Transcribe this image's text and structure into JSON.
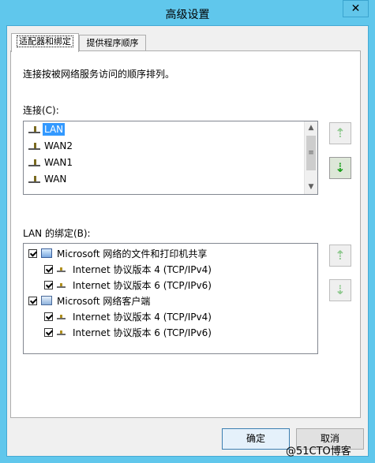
{
  "window": {
    "title": "高级设置",
    "close_glyph": "✕"
  },
  "tabs": [
    {
      "label": "适配器和绑定",
      "active": true
    },
    {
      "label": "提供程序顺序",
      "active": false
    }
  ],
  "panel": {
    "instruction": "连接按被网络服务访问的顺序排列。",
    "connections_label": "连接(C):",
    "connections": [
      {
        "name": "LAN",
        "icon": "network-adapter-icon",
        "selected": true
      },
      {
        "name": "WAN2",
        "icon": "network-adapter-icon",
        "selected": false
      },
      {
        "name": "WAN1",
        "icon": "network-adapter-icon",
        "selected": false
      },
      {
        "name": "WAN",
        "icon": "network-adapter-icon",
        "selected": false
      }
    ],
    "bindings_label": "LAN 的绑定(B):",
    "bindings": [
      {
        "name": "Microsoft 网络的文件和打印机共享",
        "level": 0,
        "checked": true,
        "icon": "file-printer-sharing-icon"
      },
      {
        "name": "Internet 协议版本 4 (TCP/IPv4)",
        "level": 1,
        "checked": true,
        "icon": "protocol-icon"
      },
      {
        "name": "Internet 协议版本 6 (TCP/IPv6)",
        "level": 1,
        "checked": true,
        "icon": "protocol-icon"
      },
      {
        "name": "Microsoft 网络客户端",
        "level": 0,
        "checked": true,
        "icon": "network-client-icon"
      },
      {
        "name": "Internet 协议版本 4 (TCP/IPv4)",
        "level": 1,
        "checked": true,
        "icon": "protocol-icon"
      },
      {
        "name": "Internet 协议版本 6 (TCP/IPv6)",
        "level": 1,
        "checked": true,
        "icon": "protocol-icon"
      }
    ],
    "arrow_up": "⇡",
    "arrow_down": "⇣"
  },
  "buttons": {
    "ok": "确定",
    "cancel": "取消"
  },
  "watermark": "@51CTO博客",
  "colors": {
    "titlebar": "#60c7ec",
    "selection": "#3399ff",
    "arrow_active": "#1a9e1a",
    "arrow_disabled": "#8dc88d"
  }
}
